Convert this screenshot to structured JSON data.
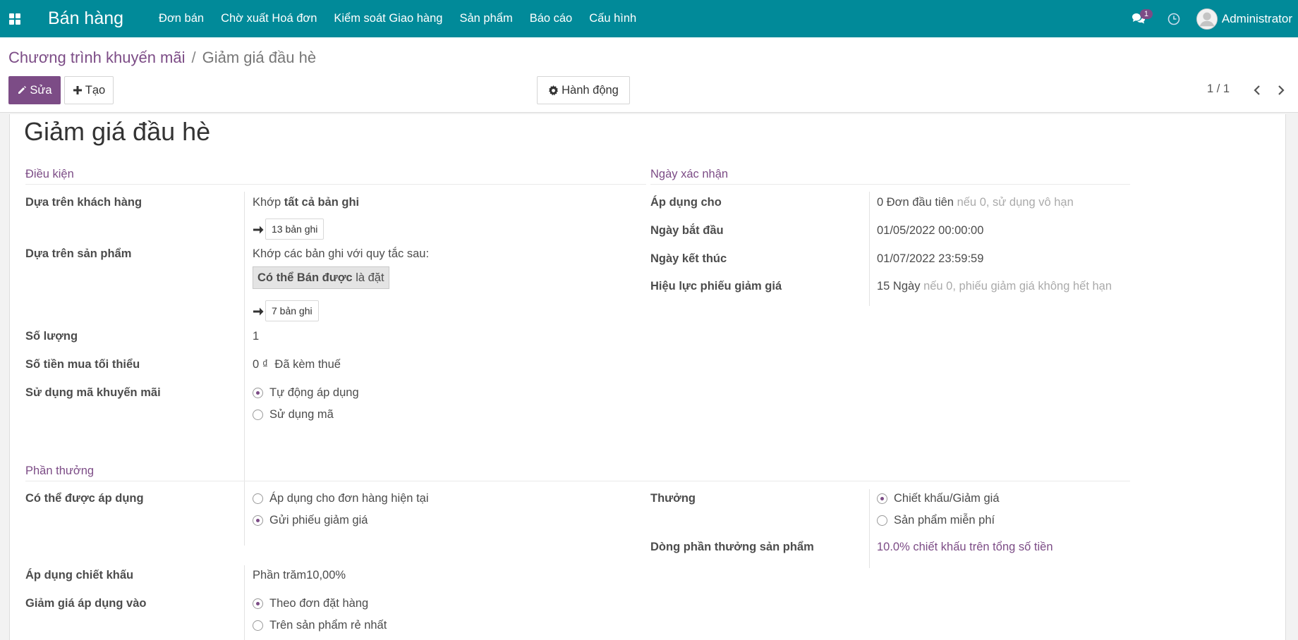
{
  "navbar": {
    "app_title": "Bán hàng",
    "menu": [
      "Đơn bán",
      "Chờ xuất Hoá đơn",
      "Kiểm soát Giao hàng",
      "Sản phẩm",
      "Báo cáo",
      "Cấu hình"
    ],
    "chat_badge": "1",
    "user": "Administrator",
    "color": "#018a99"
  },
  "breadcrumb": {
    "parent": "Chương trình khuyến mãi",
    "separator": "/",
    "current": "Giảm giá đầu hè"
  },
  "toolbar": {
    "edit_label": "Sửa",
    "create_label": "Tạo",
    "action_label": "Hành động",
    "pager": "1 / 1"
  },
  "record": {
    "title": "Giảm giá đầu hè",
    "conditions": {
      "heading": "Điều kiện",
      "customer_label": "Dựa trên khách hàng",
      "customer_match_prefix": "Khớp",
      "customer_match_all": "tất cả bản ghi",
      "customer_records": "13 bản ghi",
      "product_label": "Dựa trên sản phẩm",
      "product_rule_text": "Khớp các bản ghi với quy tắc sau:",
      "product_rule_field": "Có thể Bán được",
      "product_rule_op": "là đặt",
      "product_records": "7 bản ghi",
      "quantity_label": "Số lượng",
      "quantity_value": "1",
      "min_amount_label": "Số tiền mua tối thiểu",
      "min_amount_value": "0 ₫",
      "min_amount_tax": "Đã kèm thuế",
      "promo_code_label": "Sử dụng mã khuyến mãi",
      "promo_code_options": [
        {
          "label": "Tự động áp dụng",
          "checked": true
        },
        {
          "label": "Sử dụng mã",
          "checked": false
        }
      ]
    },
    "validity": {
      "heading": "Ngày xác nhận",
      "apply_label": "Áp dụng cho",
      "apply_value": "0 Đơn đầu tiên",
      "apply_hint": "nếu 0, sử dụng vô hạn",
      "start_label": "Ngày bắt đầu",
      "start_value": "01/05/2022 00:00:00",
      "end_label": "Ngày kết thúc",
      "end_value": "01/07/2022 23:59:59",
      "coupon_label": "Hiệu lực phiếu giảm giá",
      "coupon_value": "15 Ngày",
      "coupon_hint": "nếu 0, phiếu giảm giá không hết hạn"
    },
    "rewards": {
      "heading": "Phần thưởng",
      "applicable_label": "Có thể được áp dụng",
      "applicable_options": [
        {
          "label": "Áp dụng cho đơn hàng hiện tại",
          "checked": false
        },
        {
          "label": "Gửi phiếu giảm giá",
          "checked": true
        }
      ],
      "reward_label": "Thưởng",
      "reward_options": [
        {
          "label": "Chiết khấu/Giảm giá",
          "checked": true
        },
        {
          "label": "Sản phẩm miễn phí",
          "checked": false
        }
      ],
      "reward_line_label": "Dòng phần thưởng sản phẩm",
      "reward_line_value": "10.0% chiết khấu trên tổng số tiền",
      "discount_label": "Áp dụng chiết khấu",
      "discount_value": "Phần trăm10,00%",
      "discount_on_label": "Giảm giá áp dụng vào",
      "discount_on_options": [
        {
          "label": "Theo đơn đặt hàng",
          "checked": true
        },
        {
          "label": "Trên sản phẩm rẻ nhất",
          "checked": false
        }
      ]
    }
  }
}
